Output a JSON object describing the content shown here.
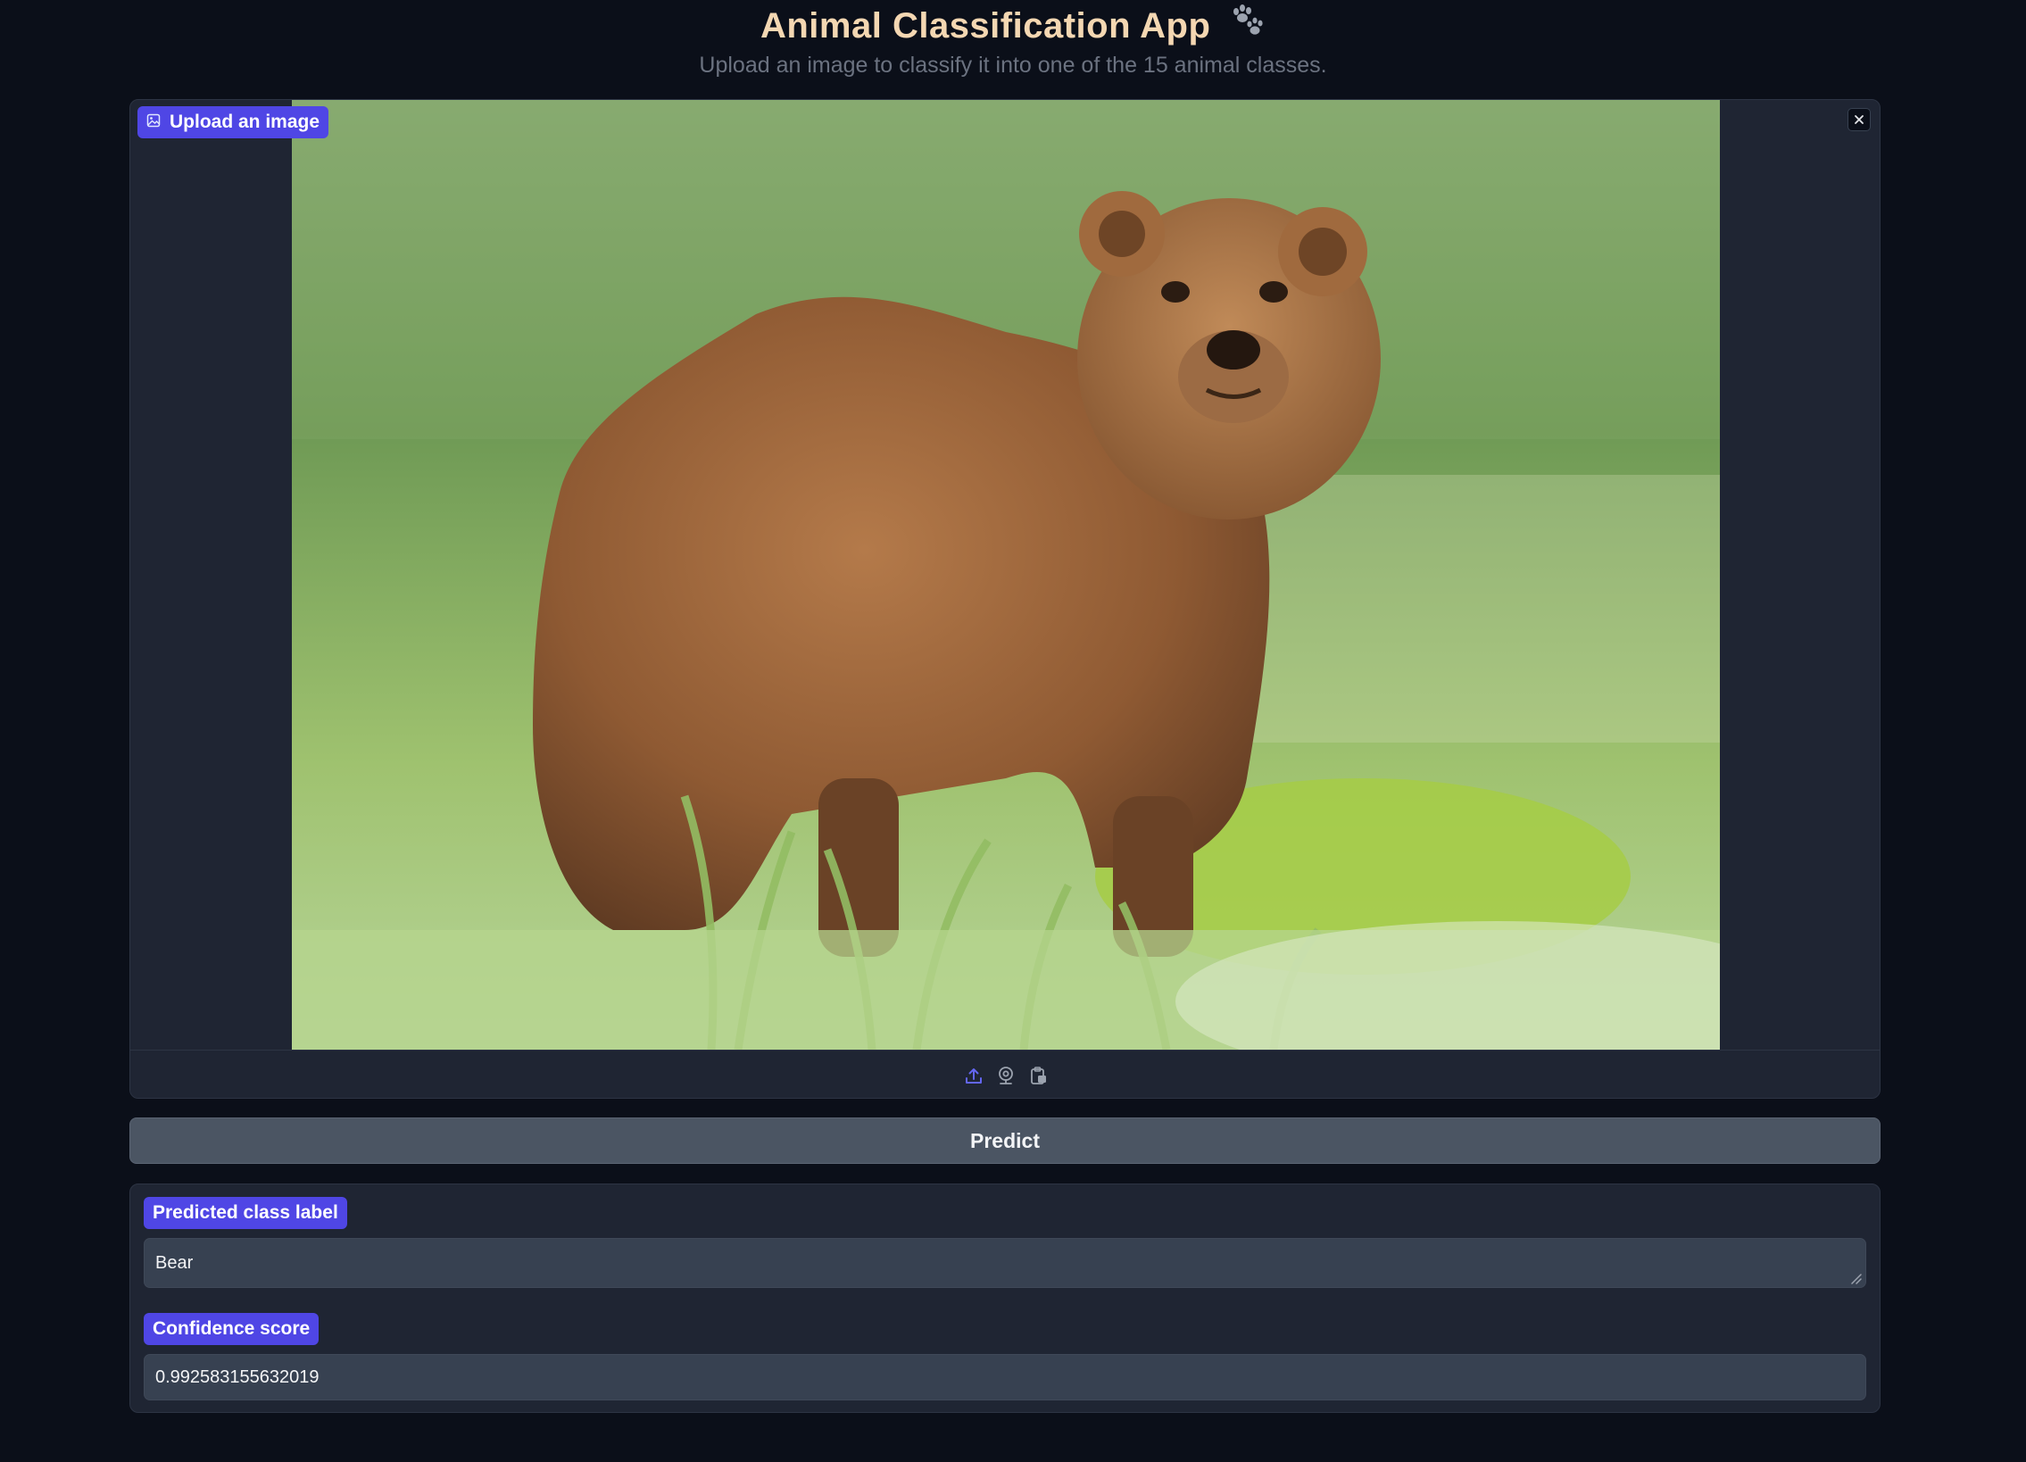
{
  "header": {
    "title": "Animal Classification App",
    "subtitle": "Upload an image to classify it into one of the 15 animal classes."
  },
  "image_input": {
    "label": "Upload an image",
    "icons": [
      "image-icon",
      "close-icon",
      "upload-icon",
      "webcam-icon",
      "clipboard-icon"
    ]
  },
  "predict_button": {
    "label": "Predict"
  },
  "outputs": {
    "predicted_label": {
      "label": "Predicted class label",
      "value": "Bear"
    },
    "confidence": {
      "label": "Confidence score",
      "value": "0.992583155632019"
    }
  },
  "colors": {
    "background": "#0b0f19",
    "panel": "#1f2533",
    "accent": "#4f46e5",
    "title": "#f4d7b2",
    "button": "#4b5563",
    "field": "#374151"
  }
}
